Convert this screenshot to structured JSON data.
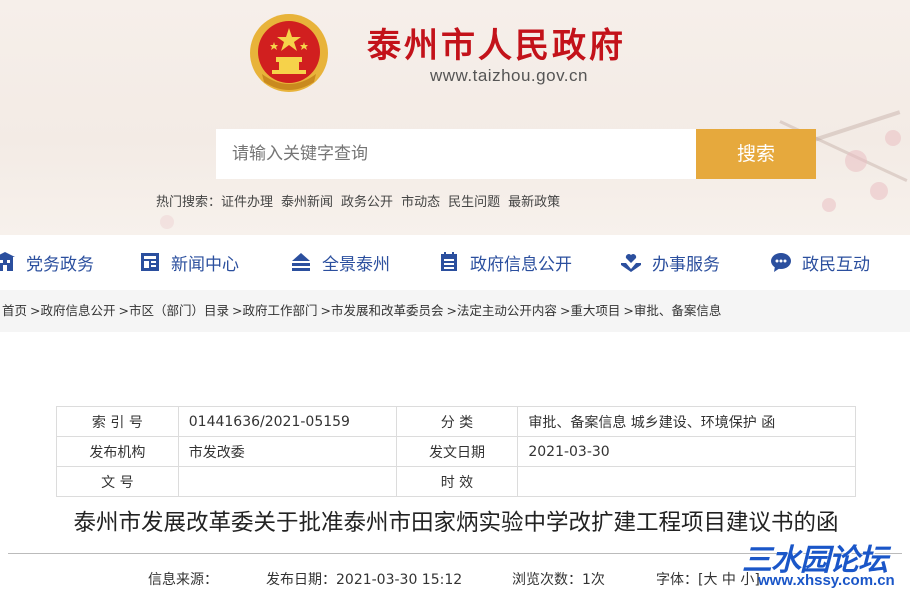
{
  "header": {
    "site_title": "泰州市人民政府",
    "site_url": "www.taizhou.gov.cn"
  },
  "search": {
    "placeholder": "请输入关键字查询",
    "button_label": "搜索"
  },
  "hot_search": {
    "label": "热门搜索：",
    "items": [
      "证件办理",
      "泰州新闻",
      "政务公开",
      "市动态",
      "民生问题",
      "最新政策"
    ]
  },
  "nav": {
    "items": [
      {
        "label": "党务政务",
        "icon": "building-icon"
      },
      {
        "label": "新闻中心",
        "icon": "newspaper-icon"
      },
      {
        "label": "全景泰州",
        "icon": "landscape-icon"
      },
      {
        "label": "政府信息公开",
        "icon": "calendar-list-icon"
      },
      {
        "label": "办事服务",
        "icon": "hands-heart-icon"
      },
      {
        "label": "政民互动",
        "icon": "chat-bubble-icon"
      }
    ]
  },
  "breadcrumb": {
    "items": [
      "首页",
      ">政府信息公开",
      ">市区（部门）目录",
      ">政府工作部门",
      ">市发展和改革委员会",
      ">法定主动公开内容",
      ">重大项目",
      ">审批、备案信息"
    ]
  },
  "meta_table": {
    "row1": {
      "l1": "索 引 号",
      "v1": "01441636/2021-05159",
      "l2": "分 类",
      "v2": "审批、备案信息 城乡建设、环境保护 函"
    },
    "row2": {
      "l1": "发布机构",
      "v1": "市发改委",
      "l2": "发文日期",
      "v2": "2021-03-30"
    },
    "row3": {
      "l1": "文 号",
      "v1": "",
      "l2": "时 效",
      "v2": ""
    }
  },
  "document": {
    "title": "泰州市发展改革委关于批准泰州市田家炳实验中学改扩建工程项目建议书的函"
  },
  "info_bar": {
    "source": "信息来源：",
    "published": "发布日期：2021-03-30 15:12",
    "views": "浏览次数：1次",
    "font_size": "字体：[大 中 小]"
  },
  "watermark": {
    "text": "三水园论坛",
    "url": "www.xhssy.com.cn"
  },
  "colors": {
    "brand_red": "#c3121a",
    "search_button": "#e6a93d",
    "nav_blue": "#2b4f9e",
    "watermark_blue": "#1a56c8"
  }
}
